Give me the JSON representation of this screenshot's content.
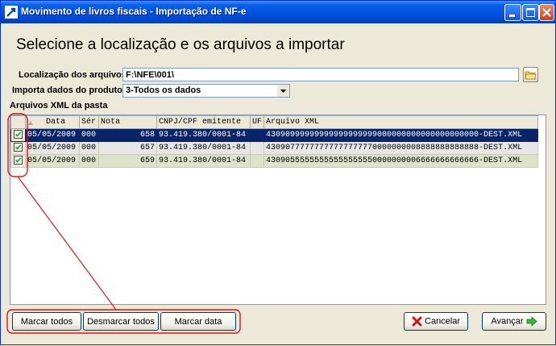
{
  "window": {
    "title": "Movimento de livros fiscais - Importação de NF-e"
  },
  "heading": "Selecione a localização e os arquivos a importar",
  "location": {
    "label": "Localização dos arquivos",
    "value": "F:\\NFE\\001\\"
  },
  "import_data": {
    "label": "Importa dados do produto",
    "selected": "3-Todos os dados"
  },
  "grid": {
    "section_label": "Arquivos XML da pasta",
    "columns": [
      "Data",
      "Sér",
      "Nota",
      "CNPJ/CPF emitente",
      "UF",
      "Arquivo XML"
    ],
    "rows": [
      {
        "checked": true,
        "date": "05/05/2009",
        "serie": "000",
        "nota": "658",
        "cnpj": "93.419.380/0001-84",
        "uf": "",
        "file": "43090999999999999999999000000000000000000000-DEST.XML"
      },
      {
        "checked": true,
        "date": "05/05/2009",
        "serie": "000",
        "nota": "657",
        "cnpj": "93.419.380/0001-84",
        "uf": "",
        "file": "43090777777777777777770000000008888888888888-DEST.XML"
      },
      {
        "checked": true,
        "date": "05/05/2009",
        "serie": "000",
        "nota": "659",
        "cnpj": "93.419.380/0001-84",
        "uf": "",
        "file": "43090555555555555555550000000006666666666666-DEST.XML"
      }
    ]
  },
  "buttons": {
    "mark_all": "Marcar todos",
    "unmark_all": "Desmarcar todos",
    "mark_date": "Marcar data",
    "cancel": "Cancelar",
    "next": "Avançar"
  },
  "colors": {
    "selection": "#0a246a",
    "annotation": "#e0141c",
    "titlebar": "#0054e3"
  }
}
